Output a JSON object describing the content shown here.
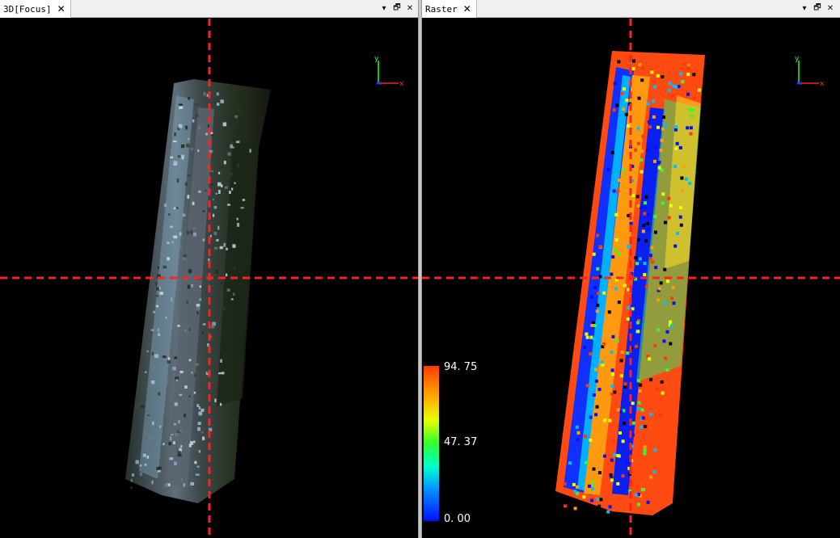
{
  "left_view": {
    "tab_label": "3D[Focus]",
    "close_glyph": "✕",
    "dropdown_glyph": "▾",
    "float_glyph": "🗗",
    "close_panel_glyph": "✕",
    "axis": {
      "x": "x",
      "y": "y"
    }
  },
  "right_view": {
    "tab_label": "Raster",
    "close_glyph": "✕",
    "dropdown_glyph": "▾",
    "float_glyph": "🗗",
    "close_panel_glyph": "✕",
    "axis": {
      "x": "x",
      "y": "y"
    },
    "legend": {
      "max": "94. 75",
      "mid": "47. 37",
      "min": "0. 00"
    }
  },
  "colors": {
    "crosshair": "#ff2020",
    "background": "#000000",
    "axis_x": "#ff2020",
    "axis_y": "#20ff20"
  }
}
